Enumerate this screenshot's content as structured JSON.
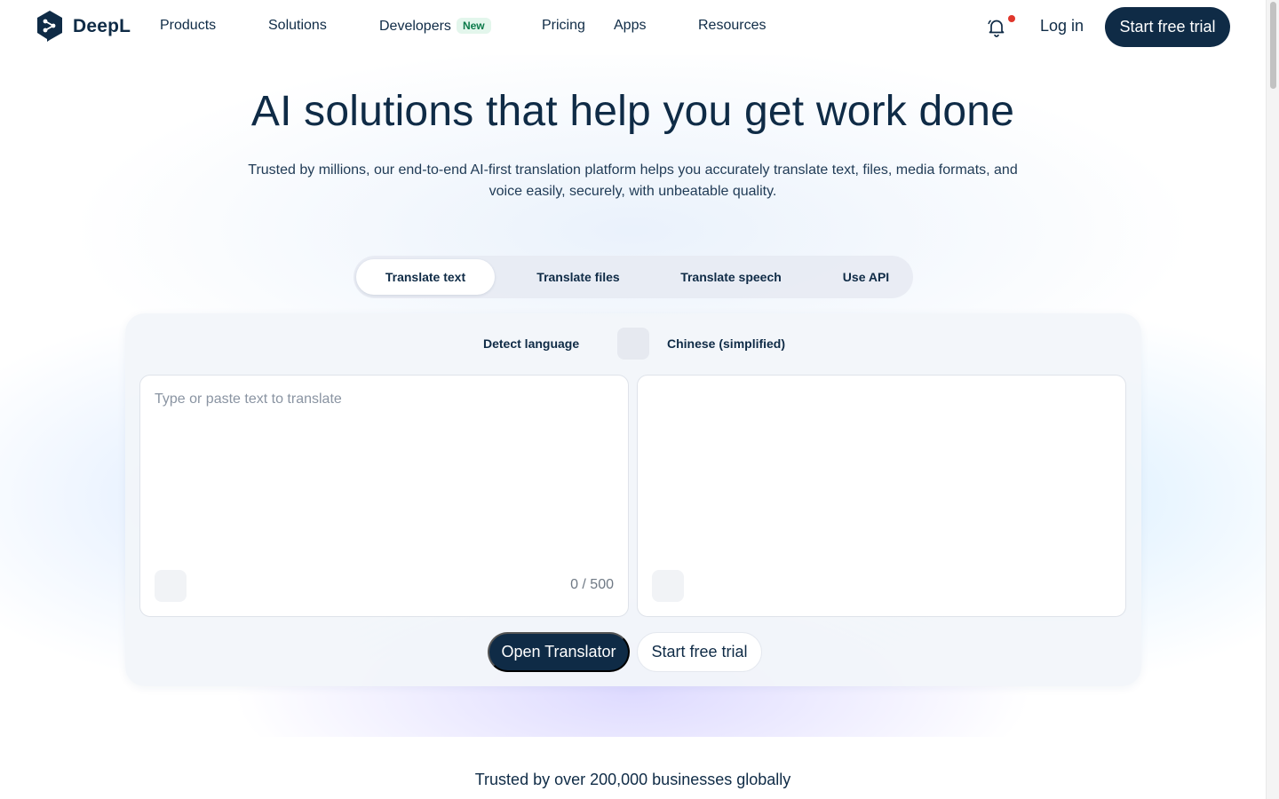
{
  "brand": {
    "name": "DeepL",
    "accent": "#0f2b46",
    "new_badge_color": "#0b7a4a",
    "notification_dot_color": "#e0362b"
  },
  "nav": {
    "items": [
      {
        "label": "Products"
      },
      {
        "label": "Solutions"
      },
      {
        "label": "Developers",
        "badge": "New"
      },
      {
        "label": "Pricing"
      },
      {
        "label": "Apps"
      },
      {
        "label": "Resources"
      }
    ],
    "notifications_icon": "bell-icon",
    "login_label": "Log in",
    "trial_label": "Start free trial"
  },
  "hero": {
    "title": "AI solutions that help you get work done",
    "subtitle": "Trusted by millions, our end-to-end AI-first translation platform helps you accurately translate text, files, media formats, and voice easily, securely, with unbeatable quality."
  },
  "tabs": [
    {
      "label": "Translate text",
      "active": true
    },
    {
      "label": "Translate files",
      "active": false
    },
    {
      "label": "Translate speech",
      "active": false
    },
    {
      "label": "Use API",
      "active": false
    }
  ],
  "translator": {
    "source_language": "Detect language",
    "target_language": "Chinese (simplified)",
    "swap_icon": "swap-languages-icon",
    "input_placeholder": "Type or paste text to translate",
    "input_value": "",
    "char_count": "0 / 500",
    "output_value": "",
    "open_button": "Open Translator",
    "trial_button": "Start free trial"
  },
  "footer_teaser": {
    "text": "Trusted by over 200,000 businesses globally"
  }
}
